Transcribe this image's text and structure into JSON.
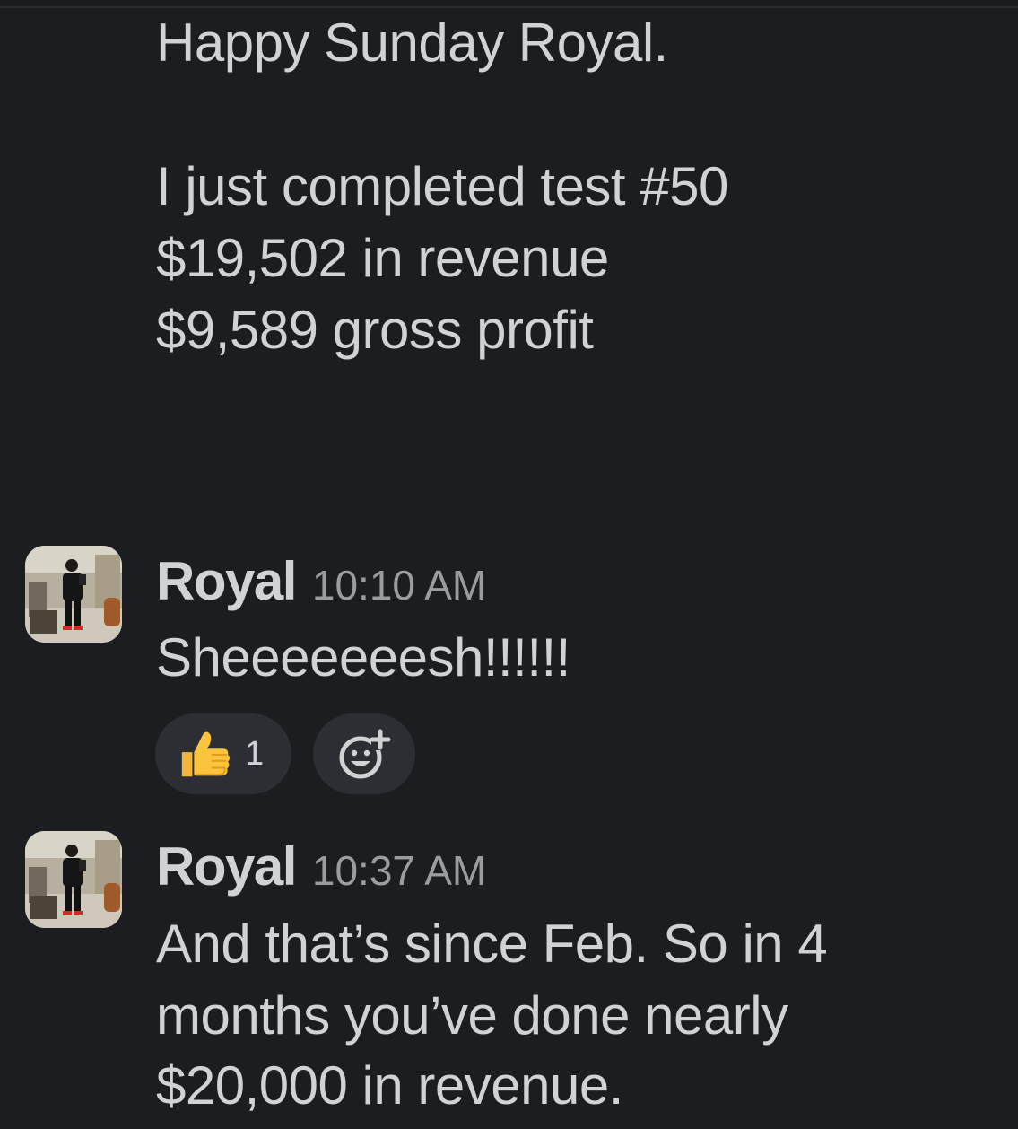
{
  "previous_message": {
    "greeting": "Happy Sunday Royal.",
    "lines": [
      "I just completed test #50",
      "$19,502 in revenue",
      "$9,589 gross profit"
    ]
  },
  "messages": [
    {
      "sender": "Royal",
      "time": "10:10 AM",
      "text": "Sheeeeeeesh!!!!!!",
      "reactions": [
        {
          "emoji": "thumbs-up-icon",
          "count": "1"
        }
      ]
    },
    {
      "sender": "Royal",
      "time": "10:37 AM",
      "lines": [
        "And that’s since Feb. So in 4",
        "months you’ve done nearly",
        "$20,000 in revenue."
      ]
    }
  ],
  "colors": {
    "background": "#1b1d21",
    "text": "#d1d2d3",
    "timestamp": "#9b9c9e",
    "reaction_pill": "#2c2e33"
  }
}
